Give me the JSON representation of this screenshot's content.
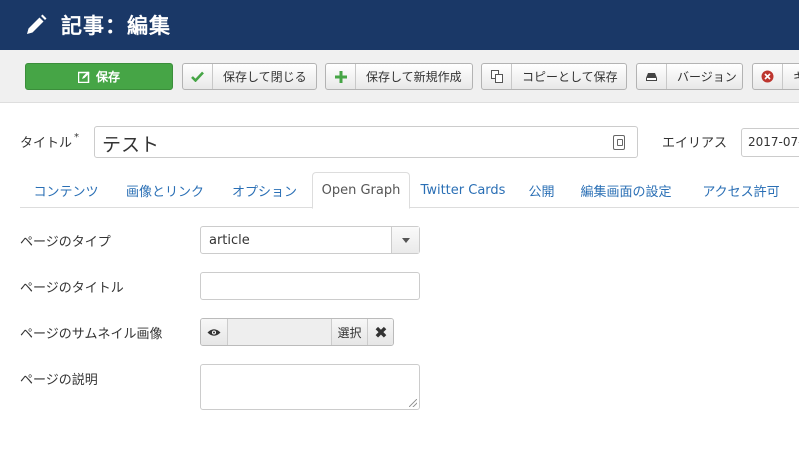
{
  "header": {
    "title": "記事：編集",
    "icon": "pencil-icon"
  },
  "toolbar": {
    "save_label": "保存",
    "save_close_label": "保存して閉じる",
    "save_new_label": "保存して新規作成",
    "save_copy_label": "コピーとして保存",
    "versions_label": "バージョン",
    "close_label": "キ"
  },
  "form": {
    "title_label": "タイトル",
    "required_mark": "*",
    "title_value": "テスト",
    "alias_label": "エイリアス",
    "alias_value": "2017-07-"
  },
  "tabs": [
    "コンテンツ",
    "画像とリンク",
    "オプション",
    "Open Graph",
    "Twitter Cards",
    "公開",
    "編集画面の設定",
    "アクセス許可"
  ],
  "active_tab": "Open Graph",
  "og": {
    "type_label": "ページのタイプ",
    "type_value": "article",
    "title_label": "ページのタイトル",
    "title_value": "",
    "image_label": "ページのサムネイル画像",
    "image_select_label": "選択",
    "image_clear_label": "✖",
    "desc_label": "ページの説明",
    "desc_value": ""
  },
  "colors": {
    "header_bg": "#1a3867",
    "save_green": "#46a546",
    "link_blue": "#2a6fb5"
  }
}
